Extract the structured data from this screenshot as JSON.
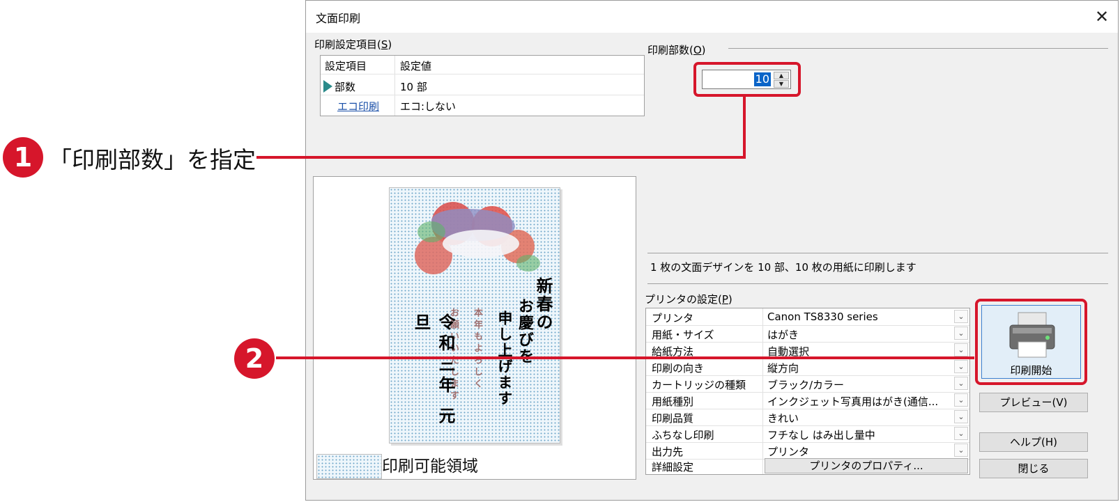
{
  "dialog": {
    "title": "文面印刷",
    "close_symbol": "✕"
  },
  "settings_group": {
    "label": "印刷設定項目(",
    "mnemonic": "S",
    "label_end": ")",
    "col_item": "設定項目",
    "col_value": "設定値",
    "rows": [
      {
        "item": "部数",
        "value": "10 部",
        "selected": true
      },
      {
        "item": "エコ印刷",
        "value": "エコ:しない",
        "link": true
      }
    ]
  },
  "copies": {
    "label": "印刷部数(",
    "mnemonic": "O",
    "label_end": ")",
    "value": "10",
    "spin_up": "▲",
    "spin_down": "▼"
  },
  "preview": {
    "card_title": "新春の",
    "card_line2": "お慶びを",
    "card_line3": "申し上げます",
    "card_small1": "本年もよろしく",
    "card_small2": "お願いいたします",
    "card_date": "令和三年 元旦",
    "legend_label": "印刷可能領域"
  },
  "summary": "1 枚の文面デザインを 10 部、10 枚の用紙に印刷します",
  "printer_group": {
    "label": "プリンタの設定(",
    "mnemonic": "P",
    "label_end": ")",
    "rows": [
      {
        "item": "プリンタ",
        "value": "Canon TS8330 series"
      },
      {
        "item": "用紙・サイズ",
        "value": "はがき"
      },
      {
        "item": "給紙方法",
        "value": "自動選択"
      },
      {
        "item": "印刷の向き",
        "value": "縦方向"
      },
      {
        "item": "カートリッジの種類",
        "value": "ブラック/カラー"
      },
      {
        "item": "用紙種別",
        "value": "インクジェット写真用はがき(通信..."
      },
      {
        "item": "印刷品質",
        "value": "きれい"
      },
      {
        "item": "ふちなし印刷",
        "value": "フチなし はみ出し量中"
      },
      {
        "item": "出力先",
        "value": "プリンタ"
      },
      {
        "item": "詳細設定",
        "button": "プリンタのプロパティ..."
      }
    ],
    "dropdown_symbol": "⌄"
  },
  "buttons": {
    "start": "印刷開始",
    "preview": "プレビュー(V)",
    "help": "ヘルプ(H)",
    "close": "閉じる"
  },
  "callouts": [
    {
      "number": "1",
      "text": "「印刷部数」を指定"
    },
    {
      "number": "2",
      "text": ""
    }
  ],
  "colors": {
    "accent_red": "#d6162b",
    "selection_blue": "#0a64c8",
    "link_blue": "#1a4fa8"
  }
}
